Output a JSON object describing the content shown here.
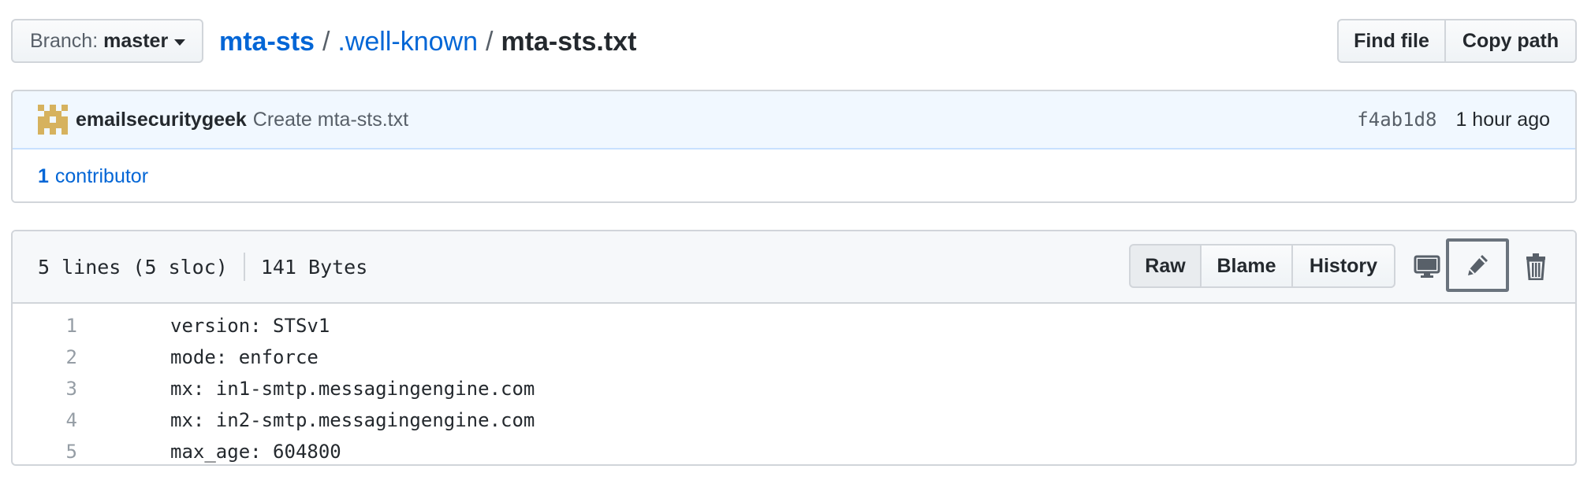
{
  "branch": {
    "prefix": "Branch:",
    "name": "master"
  },
  "breadcrumb": {
    "repo": "mta-sts",
    "sep1": "/",
    "dir": ".well-known",
    "sep2": "/",
    "file": "mta-sts.txt"
  },
  "top_buttons": {
    "find_file": "Find file",
    "copy_path": "Copy path"
  },
  "commit": {
    "author": "emailsecuritygeek",
    "message": "Create mta-sts.txt",
    "sha": "f4ab1d8",
    "time": "1 hour ago",
    "contributors_count": "1",
    "contributors_label": "contributor"
  },
  "file": {
    "lines_info": "5 lines (5 sloc)",
    "size": "141 Bytes",
    "actions": {
      "raw": "Raw",
      "blame": "Blame",
      "history": "History"
    },
    "icons": {
      "desktop": "desktop-icon",
      "edit": "pencil-icon",
      "delete": "trash-icon"
    },
    "lines": [
      {
        "num": "1",
        "text": "version: STSv1"
      },
      {
        "num": "2",
        "text": "mode: enforce"
      },
      {
        "num": "3",
        "text": "mx: in1-smtp.messagingengine.com"
      },
      {
        "num": "4",
        "text": "mx: in2-smtp.messagingengine.com"
      },
      {
        "num": "5",
        "text": "max_age: 604800"
      }
    ]
  },
  "colors": {
    "link": "#0366d6",
    "border": "#d1d5da",
    "commit_bg": "#f1f8ff",
    "header_bg": "#f6f8fa"
  }
}
